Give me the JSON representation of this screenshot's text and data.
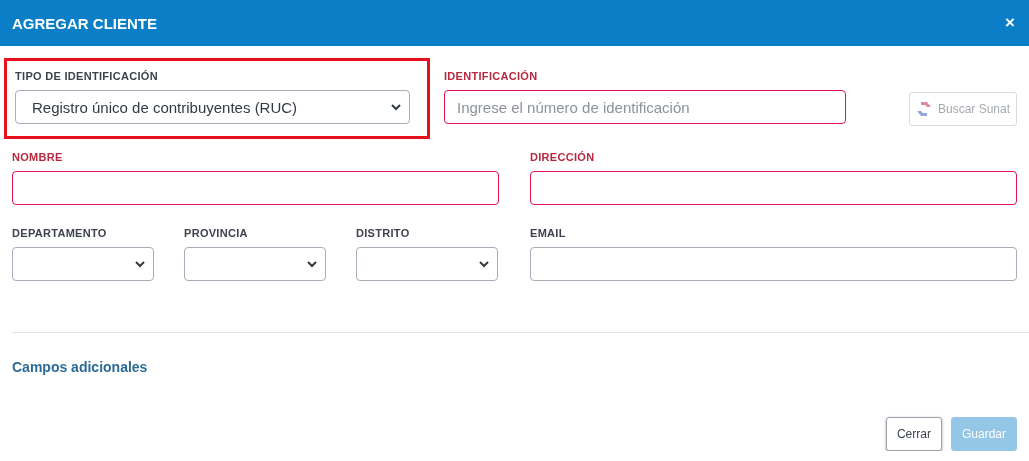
{
  "dialog": {
    "title": "AGREGAR CLIENTE",
    "close": "×"
  },
  "id_type": {
    "label": "TIPO DE IDENTIFICACIÓN",
    "value": "Registro único de contribuyentes (RUC)",
    "required": false,
    "highlighted": true
  },
  "identification": {
    "label": "IDENTIFICACIÓN",
    "placeholder": "Ingrese el número de identificación",
    "required": true
  },
  "sunat_button": {
    "label": "Buscar Sunat",
    "disabled": true
  },
  "name": {
    "label": "NOMBRE",
    "required": true
  },
  "address": {
    "label": "DIRECCIÓN",
    "required": true
  },
  "location": [
    {
      "label": "DEPARTAMENTO",
      "required": false
    },
    {
      "label": "PROVINCIA",
      "required": false
    },
    {
      "label": "DISTRITO",
      "required": false
    }
  ],
  "email": {
    "label": "EMAIL",
    "required": false
  },
  "extra_fields_link": "Campos adicionales",
  "buttons": [
    {
      "label": "Cerrar",
      "kind": "secondary",
      "disabled": false
    },
    {
      "label": "Guardar",
      "kind": "primary",
      "disabled": true
    }
  ]
}
